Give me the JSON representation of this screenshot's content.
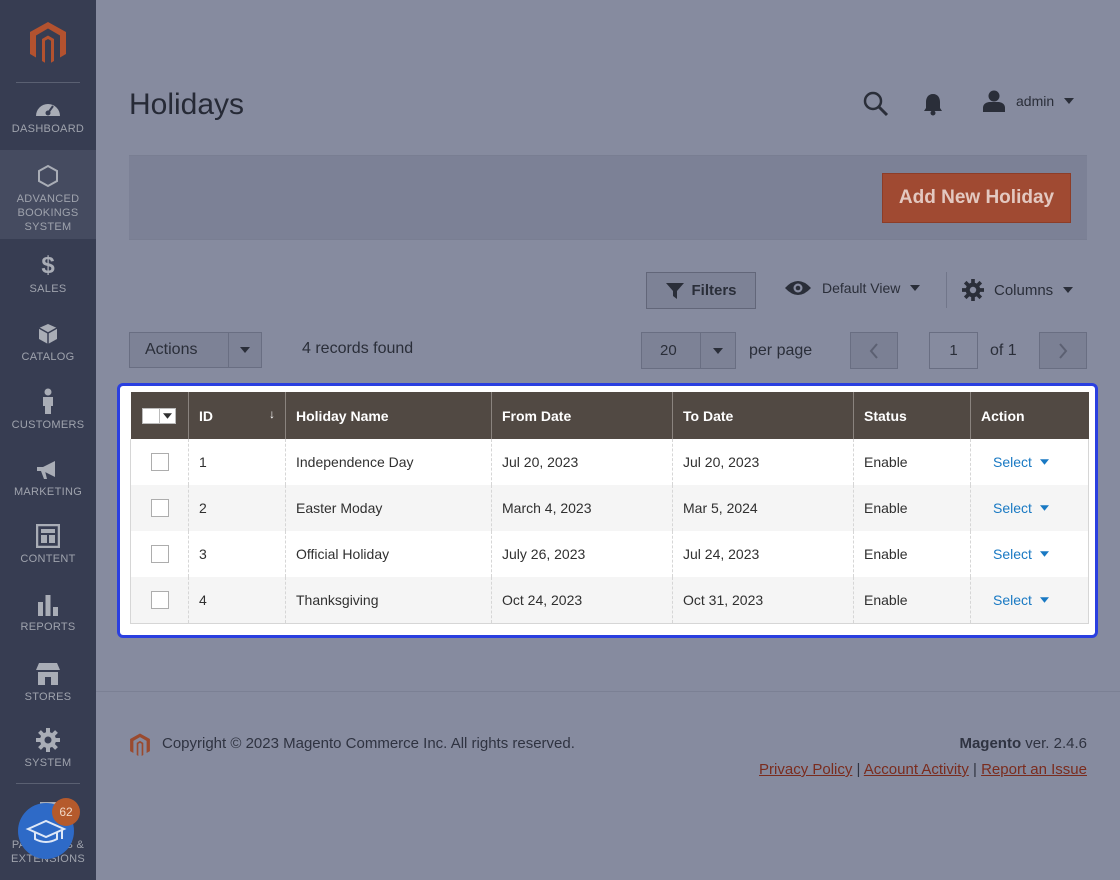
{
  "sidebar": {
    "items": [
      {
        "label": "DASHBOARD",
        "icon": "dashboard-icon"
      },
      {
        "label": "ADVANCED BOOKINGS SYSTEM",
        "icon": "hexagon-icon"
      },
      {
        "label": "SALES",
        "icon": "dollar-icon"
      },
      {
        "label": "CATALOG",
        "icon": "box-icon"
      },
      {
        "label": "CUSTOMERS",
        "icon": "person-icon"
      },
      {
        "label": "MARKETING",
        "icon": "megaphone-icon"
      },
      {
        "label": "CONTENT",
        "icon": "layout-icon"
      },
      {
        "label": "REPORTS",
        "icon": "bar-chart-icon"
      },
      {
        "label": "STORES",
        "icon": "store-icon"
      },
      {
        "label": "SYSTEM",
        "icon": "gear-icon"
      },
      {
        "label": "FIND PARTNERS & EXTENSIONS",
        "icon": "extensions-icon"
      }
    ],
    "help_badge": "62"
  },
  "header": {
    "title": "Holidays",
    "user": "admin"
  },
  "actionbar": {
    "add_label": "Add New Holiday"
  },
  "toolbar": {
    "filters_label": "Filters",
    "view_label": "Default View",
    "columns_label": "Columns",
    "actions_label": "Actions",
    "records": "4 records found",
    "per_page_value": "20",
    "per_page_label": "per page",
    "page_value": "1",
    "page_of": "of 1"
  },
  "grid": {
    "headers": [
      "ID",
      "Holiday Name",
      "From Date",
      "To Date",
      "Status",
      "Action"
    ],
    "rows": [
      {
        "id": "1",
        "name": "Independence Day",
        "from": "Jul 20, 2023",
        "to": "Jul 20, 2023",
        "status": "Enable",
        "action": "Select"
      },
      {
        "id": "2",
        "name": "Easter Moday",
        "from": "March 4, 2023",
        "to": "Mar 5, 2024",
        "status": "Enable",
        "action": "Select"
      },
      {
        "id": "3",
        "name": "Official Holiday",
        "from": "July 26, 2023",
        "to": "Jul 24, 2023",
        "status": "Enable",
        "action": "Select"
      },
      {
        "id": "4",
        "name": "Thanksgiving",
        "from": "Oct 24, 2023",
        "to": "Oct 31, 2023",
        "status": "Enable",
        "action": "Select"
      }
    ]
  },
  "footer": {
    "copyright": "Copyright © 2023 Magento Commerce Inc. All rights reserved.",
    "brand": "Magento",
    "version": " ver. 2.4.6",
    "link_privacy": "Privacy Policy",
    "link_activity": "Account Activity",
    "link_report": "Report an Issue",
    "sep": "|"
  },
  "colors": {
    "sidebar_bg": "#373d52",
    "accent": "#a04a32",
    "grid_header": "#514943",
    "link": "#1979c3",
    "highlight": "#2a3fe0"
  }
}
